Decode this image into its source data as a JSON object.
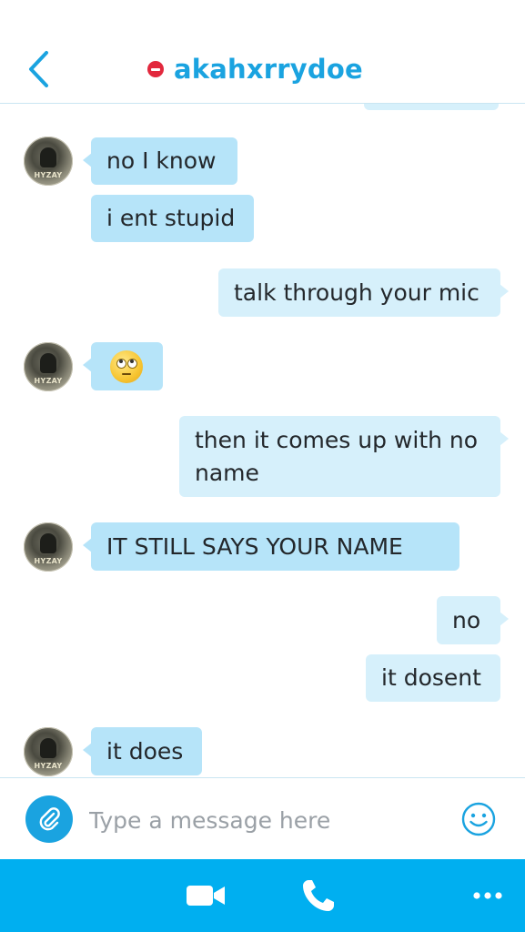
{
  "header": {
    "contact_name": "akahxrrydoe",
    "status": "do-not-disturb",
    "back_icon": "chevron-left-icon"
  },
  "avatar": {
    "badge_text": "HYZAY"
  },
  "messages": [
    {
      "direction": "incoming",
      "text": "no I know"
    },
    {
      "direction": "incoming",
      "text": "i ent stupid"
    },
    {
      "direction": "outgoing",
      "text": "talk through your mic"
    },
    {
      "direction": "incoming",
      "text": "",
      "emoji": "eye-roll-emoji"
    },
    {
      "direction": "outgoing",
      "text": "then it comes up with no name"
    },
    {
      "direction": "incoming",
      "text": "IT STILL SAYS YOUR NAME"
    },
    {
      "direction": "outgoing",
      "text": "no"
    },
    {
      "direction": "outgoing",
      "text": "it dosent"
    },
    {
      "direction": "incoming",
      "text": "it does"
    }
  ],
  "composer": {
    "placeholder": "Type a message here",
    "attach_icon": "paperclip-icon",
    "emoji_icon": "smiley-icon"
  },
  "bottom_bar": {
    "video_icon": "video-call-icon",
    "call_icon": "phone-icon",
    "more_icon": "more-icon"
  },
  "colors": {
    "accent": "#1aa3e0",
    "bottom_bar": "#00aff0",
    "incoming_bubble": "#b6e4f9",
    "outgoing_bubble": "#d6f0fb",
    "status_red": "#e2283d"
  }
}
